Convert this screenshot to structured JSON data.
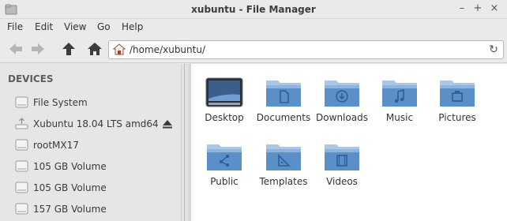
{
  "window": {
    "title": "xubuntu - File Manager"
  },
  "menu": [
    "File",
    "Edit",
    "View",
    "Go",
    "Help"
  ],
  "toolbar": {
    "path": "/home/xubuntu/"
  },
  "sidebar": {
    "header": "DEVICES",
    "devices": [
      {
        "label": "File System",
        "icon": "harddisk-icon"
      },
      {
        "label": "Xubuntu 18.04 LTS amd64",
        "icon": "usb-drive-icon",
        "eject": true
      },
      {
        "label": "rootMX17",
        "icon": "harddisk-icon"
      },
      {
        "label": "105 GB Volume",
        "icon": "harddisk-icon"
      },
      {
        "label": "105 GB Volume",
        "icon": "harddisk-icon"
      },
      {
        "label": "157 GB Volume",
        "icon": "harddisk-icon"
      }
    ]
  },
  "content": {
    "items": [
      {
        "label": "Desktop",
        "icon": "desktop-folder-icon"
      },
      {
        "label": "Documents",
        "icon": "documents-folder-icon"
      },
      {
        "label": "Downloads",
        "icon": "downloads-folder-icon"
      },
      {
        "label": "Music",
        "icon": "music-folder-icon"
      },
      {
        "label": "Pictures",
        "icon": "pictures-folder-icon"
      },
      {
        "label": "Public",
        "icon": "public-folder-icon"
      },
      {
        "label": "Templates",
        "icon": "templates-folder-icon"
      },
      {
        "label": "Videos",
        "icon": "videos-folder-icon"
      }
    ]
  },
  "colors": {
    "folder": "#5b8fc7",
    "folder_light": "#8cb4de",
    "folder_tab": "#a9c7e8"
  }
}
